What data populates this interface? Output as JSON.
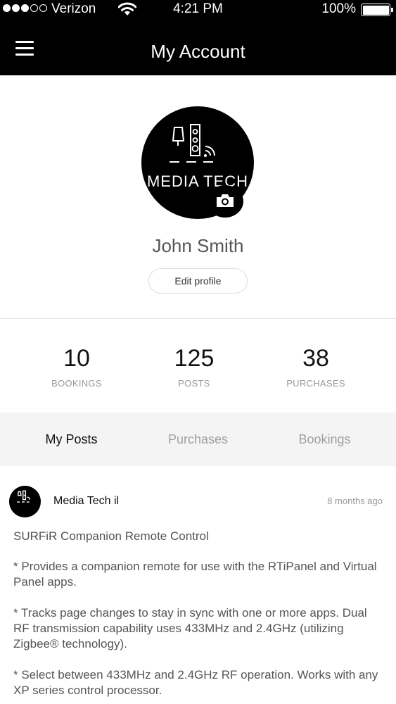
{
  "status_bar": {
    "carrier": "Verizon",
    "time": "4:21 PM",
    "battery": "100%",
    "signal_bars": 3,
    "signal_total": 5
  },
  "nav": {
    "title": "My Account",
    "menu_icon": "hamburger-menu-icon"
  },
  "profile": {
    "logo_text": "MEDIA TECH",
    "name": "John Smith",
    "edit_label": "Edit profile",
    "camera_icon": "camera-icon"
  },
  "stats": [
    {
      "value": "10",
      "label": "BOOKINGS"
    },
    {
      "value": "125",
      "label": "POSTS"
    },
    {
      "value": "38",
      "label": "PURCHASES"
    }
  ],
  "tabs": [
    {
      "label": "My Posts",
      "active": true
    },
    {
      "label": "Purchases",
      "active": false
    },
    {
      "label": "Bookings",
      "active": false
    }
  ],
  "post": {
    "author": "Media Tech il",
    "time": "8 months ago",
    "title": "SURFiR Companion Remote Control",
    "paragraphs": [
      "* Provides a companion remote for use with the RTiPanel and Virtual Panel apps.",
      "* Tracks page changes to stay in sync with one or more apps. Dual RF transmission capability uses 433MHz and 2.4GHz (utilizing Zigbee® technology).",
      "* Select between 433MHz and 2.4GHz RF operation. Works with any XP series control processor."
    ]
  },
  "colors": {
    "nav_background": "#000000",
    "tab_background": "#f4f4f4",
    "muted_text": "#999999"
  }
}
